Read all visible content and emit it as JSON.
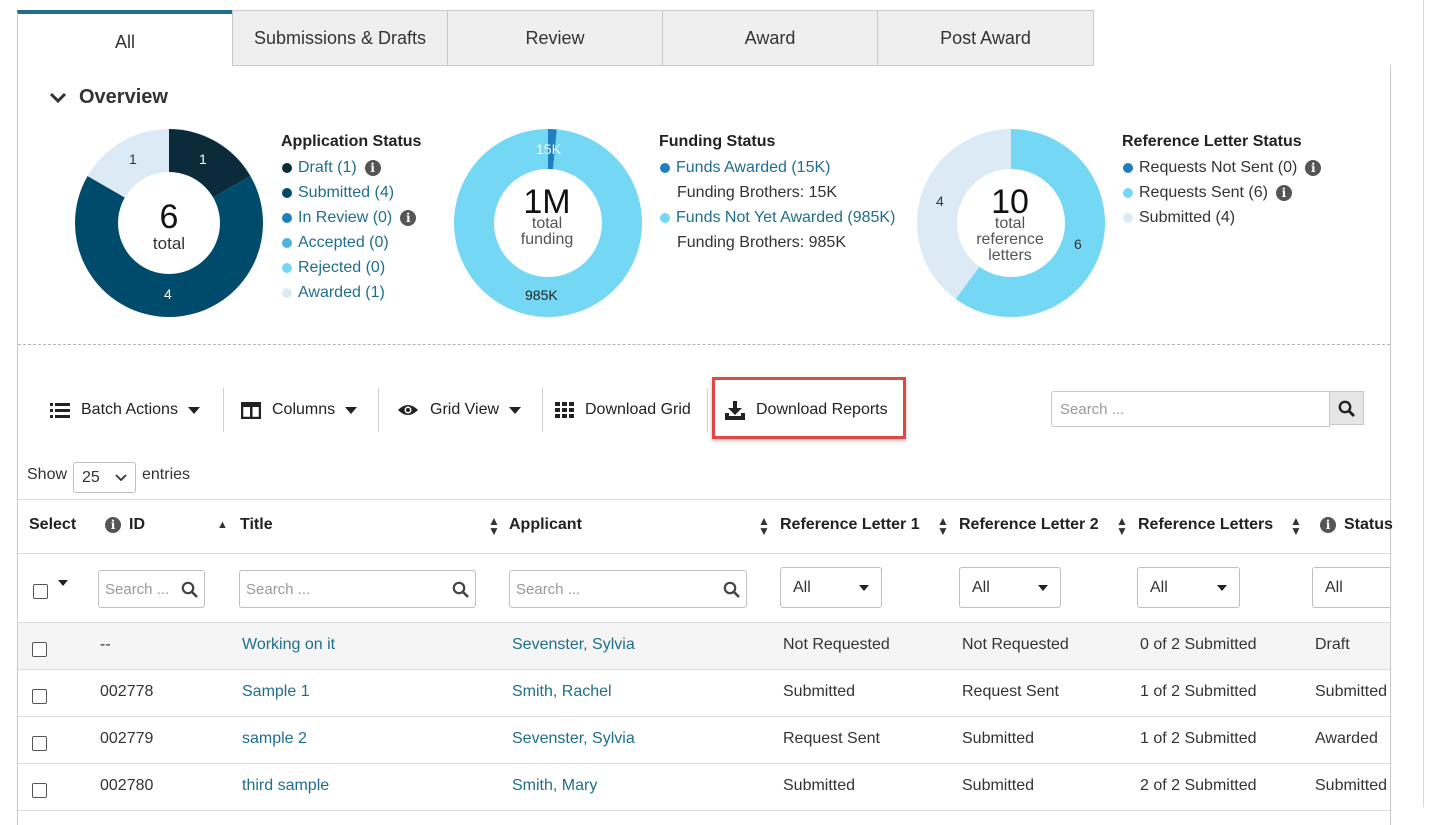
{
  "tabs": [
    "All",
    "Submissions & Drafts",
    "Review",
    "Award",
    "Post Award"
  ],
  "overview": {
    "title": "Overview",
    "application_status": {
      "title": "Application Status",
      "total": "6",
      "total_label": "total",
      "segments": [
        {
          "label": "Draft (1)",
          "count": 1,
          "color": "#0b2a3a",
          "info": true
        },
        {
          "label": "Submitted (4)",
          "count": 4,
          "color": "#004a6b",
          "info": false
        },
        {
          "label": "In Review (0)",
          "count": 0,
          "color": "#1f7fbf",
          "info": true
        },
        {
          "label": "Accepted (0)",
          "count": 0,
          "color": "#4fb3e0",
          "info": false
        },
        {
          "label": "Rejected (0)",
          "count": 0,
          "color": "#74d8f5",
          "info": false
        },
        {
          "label": "Awarded (1)",
          "count": 1,
          "color": "#dceaf6",
          "info": false
        }
      ],
      "donut_labels": [
        "1",
        "4",
        "1"
      ]
    },
    "funding_status": {
      "title": "Funding Status",
      "total": "1M",
      "total_label_1": "total",
      "total_label_2": "funding",
      "items": [
        {
          "label": "Funds Awarded (15K)",
          "color": "#1f7fbf",
          "sub": "Funding Brothers: 15K"
        },
        {
          "label": "Funds Not Yet Awarded (985K)",
          "color": "#74d8f5",
          "sub": "Funding Brothers: 985K"
        }
      ],
      "donut_labels": [
        "15K",
        "985K"
      ],
      "values": [
        15,
        985
      ]
    },
    "reference_status": {
      "title": "Reference Letter Status",
      "total": "10",
      "total_label_1": "total",
      "total_label_2": "reference",
      "total_label_3": "letters",
      "items": [
        {
          "label": "Requests Not Sent (0)",
          "color": "#1f7fbf",
          "info": true
        },
        {
          "label": "Requests Sent (6)",
          "color": "#74d8f5",
          "info": true
        },
        {
          "label": "Submitted (4)",
          "color": "#dceaf6",
          "info": false
        }
      ],
      "donut_labels": [
        "4",
        "6"
      ],
      "values": [
        6,
        4
      ]
    }
  },
  "toolbar": {
    "batch_actions": "Batch Actions",
    "columns": "Columns",
    "grid_view": "Grid View",
    "download_grid": "Download Grid",
    "download_reports": "Download Reports",
    "search_placeholder": "Search ..."
  },
  "entries": {
    "show": "Show",
    "value": "25",
    "suffix": "entries"
  },
  "table": {
    "headers": {
      "select": "Select",
      "id": "ID",
      "title": "Title",
      "applicant": "Applicant",
      "ref1": "Reference Letter 1",
      "ref2": "Reference Letter 2",
      "refs": "Reference Letters",
      "status": "Status"
    },
    "filter_placeholder": "Search ...",
    "filter_all": "All",
    "rows": [
      {
        "id": "--",
        "title": "Working on it",
        "applicant": "Sevenster, Sylvia",
        "ref1": "Not Requested",
        "ref2": "Not Requested",
        "refs": "0 of 2 Submitted",
        "status": "Draft"
      },
      {
        "id": "002778",
        "title": "Sample 1",
        "applicant": "Smith, Rachel",
        "ref1": "Submitted",
        "ref2": "Request Sent",
        "refs": "1 of 2 Submitted",
        "status": "Submitted"
      },
      {
        "id": "002779",
        "title": "sample 2",
        "applicant": "Sevenster, Sylvia",
        "ref1": "Request Sent",
        "ref2": "Submitted",
        "refs": "1 of 2 Submitted",
        "status": "Awarded"
      },
      {
        "id": "002780",
        "title": "third sample",
        "applicant": "Smith, Mary",
        "ref1": "Submitted",
        "ref2": "Submitted",
        "refs": "2 of 2 Submitted",
        "status": "Submitted"
      }
    ]
  },
  "colors": {
    "accent": "#1f6f8b",
    "highlight": "#e04848"
  }
}
